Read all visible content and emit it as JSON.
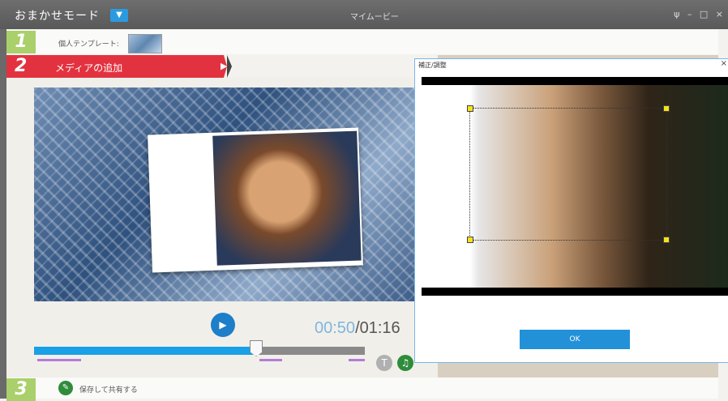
{
  "titlebar": {
    "mode_label": "おまかせモード",
    "app_title": "マイムービー",
    "win_controls": [
      "ψ",
      "–",
      "□",
      "×"
    ]
  },
  "step1": {
    "number": "1",
    "label": "個人テンプレート:"
  },
  "step2": {
    "number": "2",
    "label": "メディアの追加"
  },
  "player": {
    "current": "00:50",
    "separator": "/",
    "total": "01:16",
    "progress": 0.66
  },
  "step3": {
    "number": "3",
    "label": "保存して共有する"
  },
  "dialog": {
    "title": "補正/調整",
    "ok_label": "OK"
  },
  "colors": {
    "accent_blue": "#1aa0e6",
    "step_red": "#e3323f",
    "step_green": "#a9d06b"
  },
  "icons": {
    "dropdown": "chevron-down-icon",
    "play": "play-icon",
    "text": "text-icon",
    "music": "music-icon",
    "share": "edit-share-icon",
    "close": "close-icon"
  }
}
